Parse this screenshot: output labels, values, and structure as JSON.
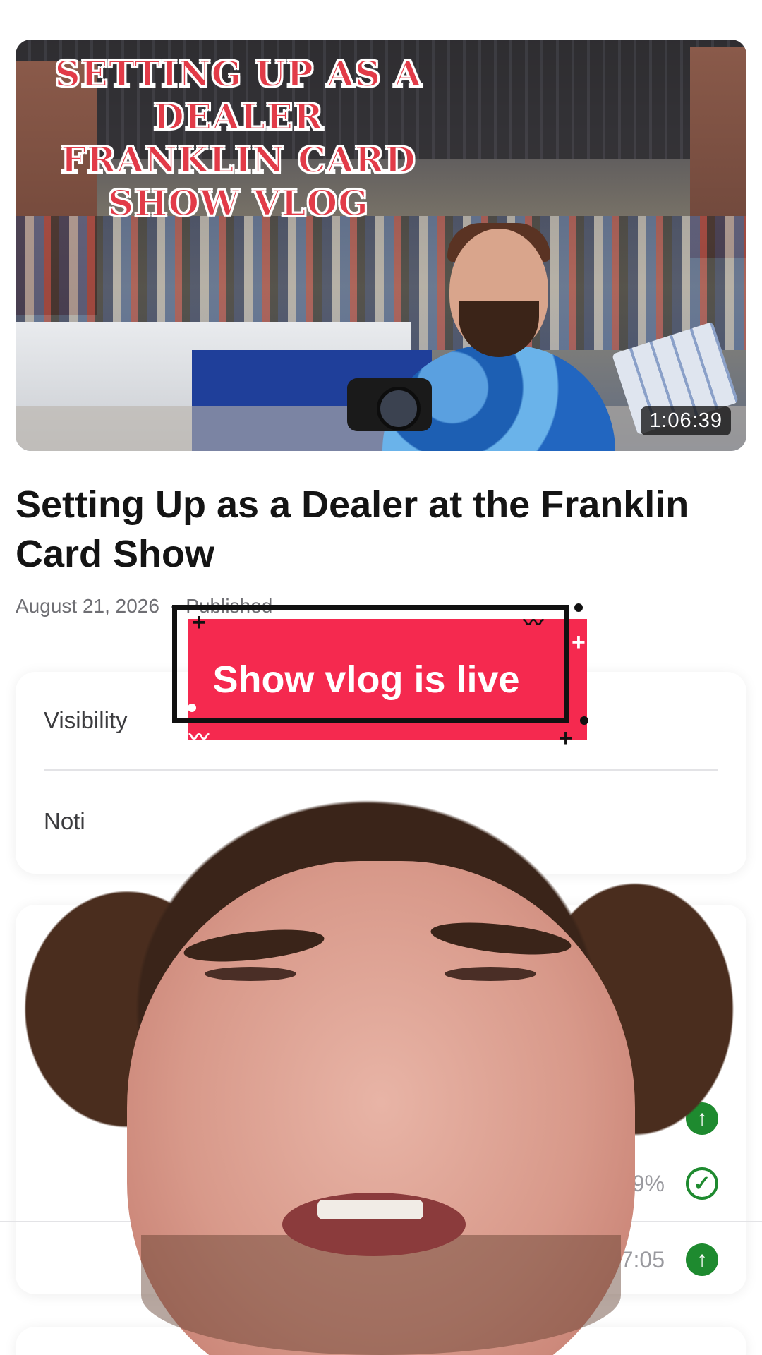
{
  "video": {
    "thumbnail_title": "Setting up as a Dealer Franklin Card Show Vlog",
    "duration": "1:06:39",
    "title": "Setting Up as a Dealer at the Franklin Card Show",
    "date": "August 21, 2026",
    "status": "Published"
  },
  "settings": {
    "visibility_label": "Visibility",
    "notify_label": "Noti"
  },
  "stats": [
    {
      "value": "",
      "icon": "arrow-up-icon"
    },
    {
      "value": "9.9%",
      "icon": "check-circle-icon"
    },
    {
      "value": "17:05",
      "icon": "arrow-up-icon"
    }
  ],
  "sticker": {
    "text": "Show vlog is live",
    "color": "#f5294f"
  },
  "colors": {
    "thumb_title": "#e23b48",
    "positive": "#1e8a2f"
  }
}
